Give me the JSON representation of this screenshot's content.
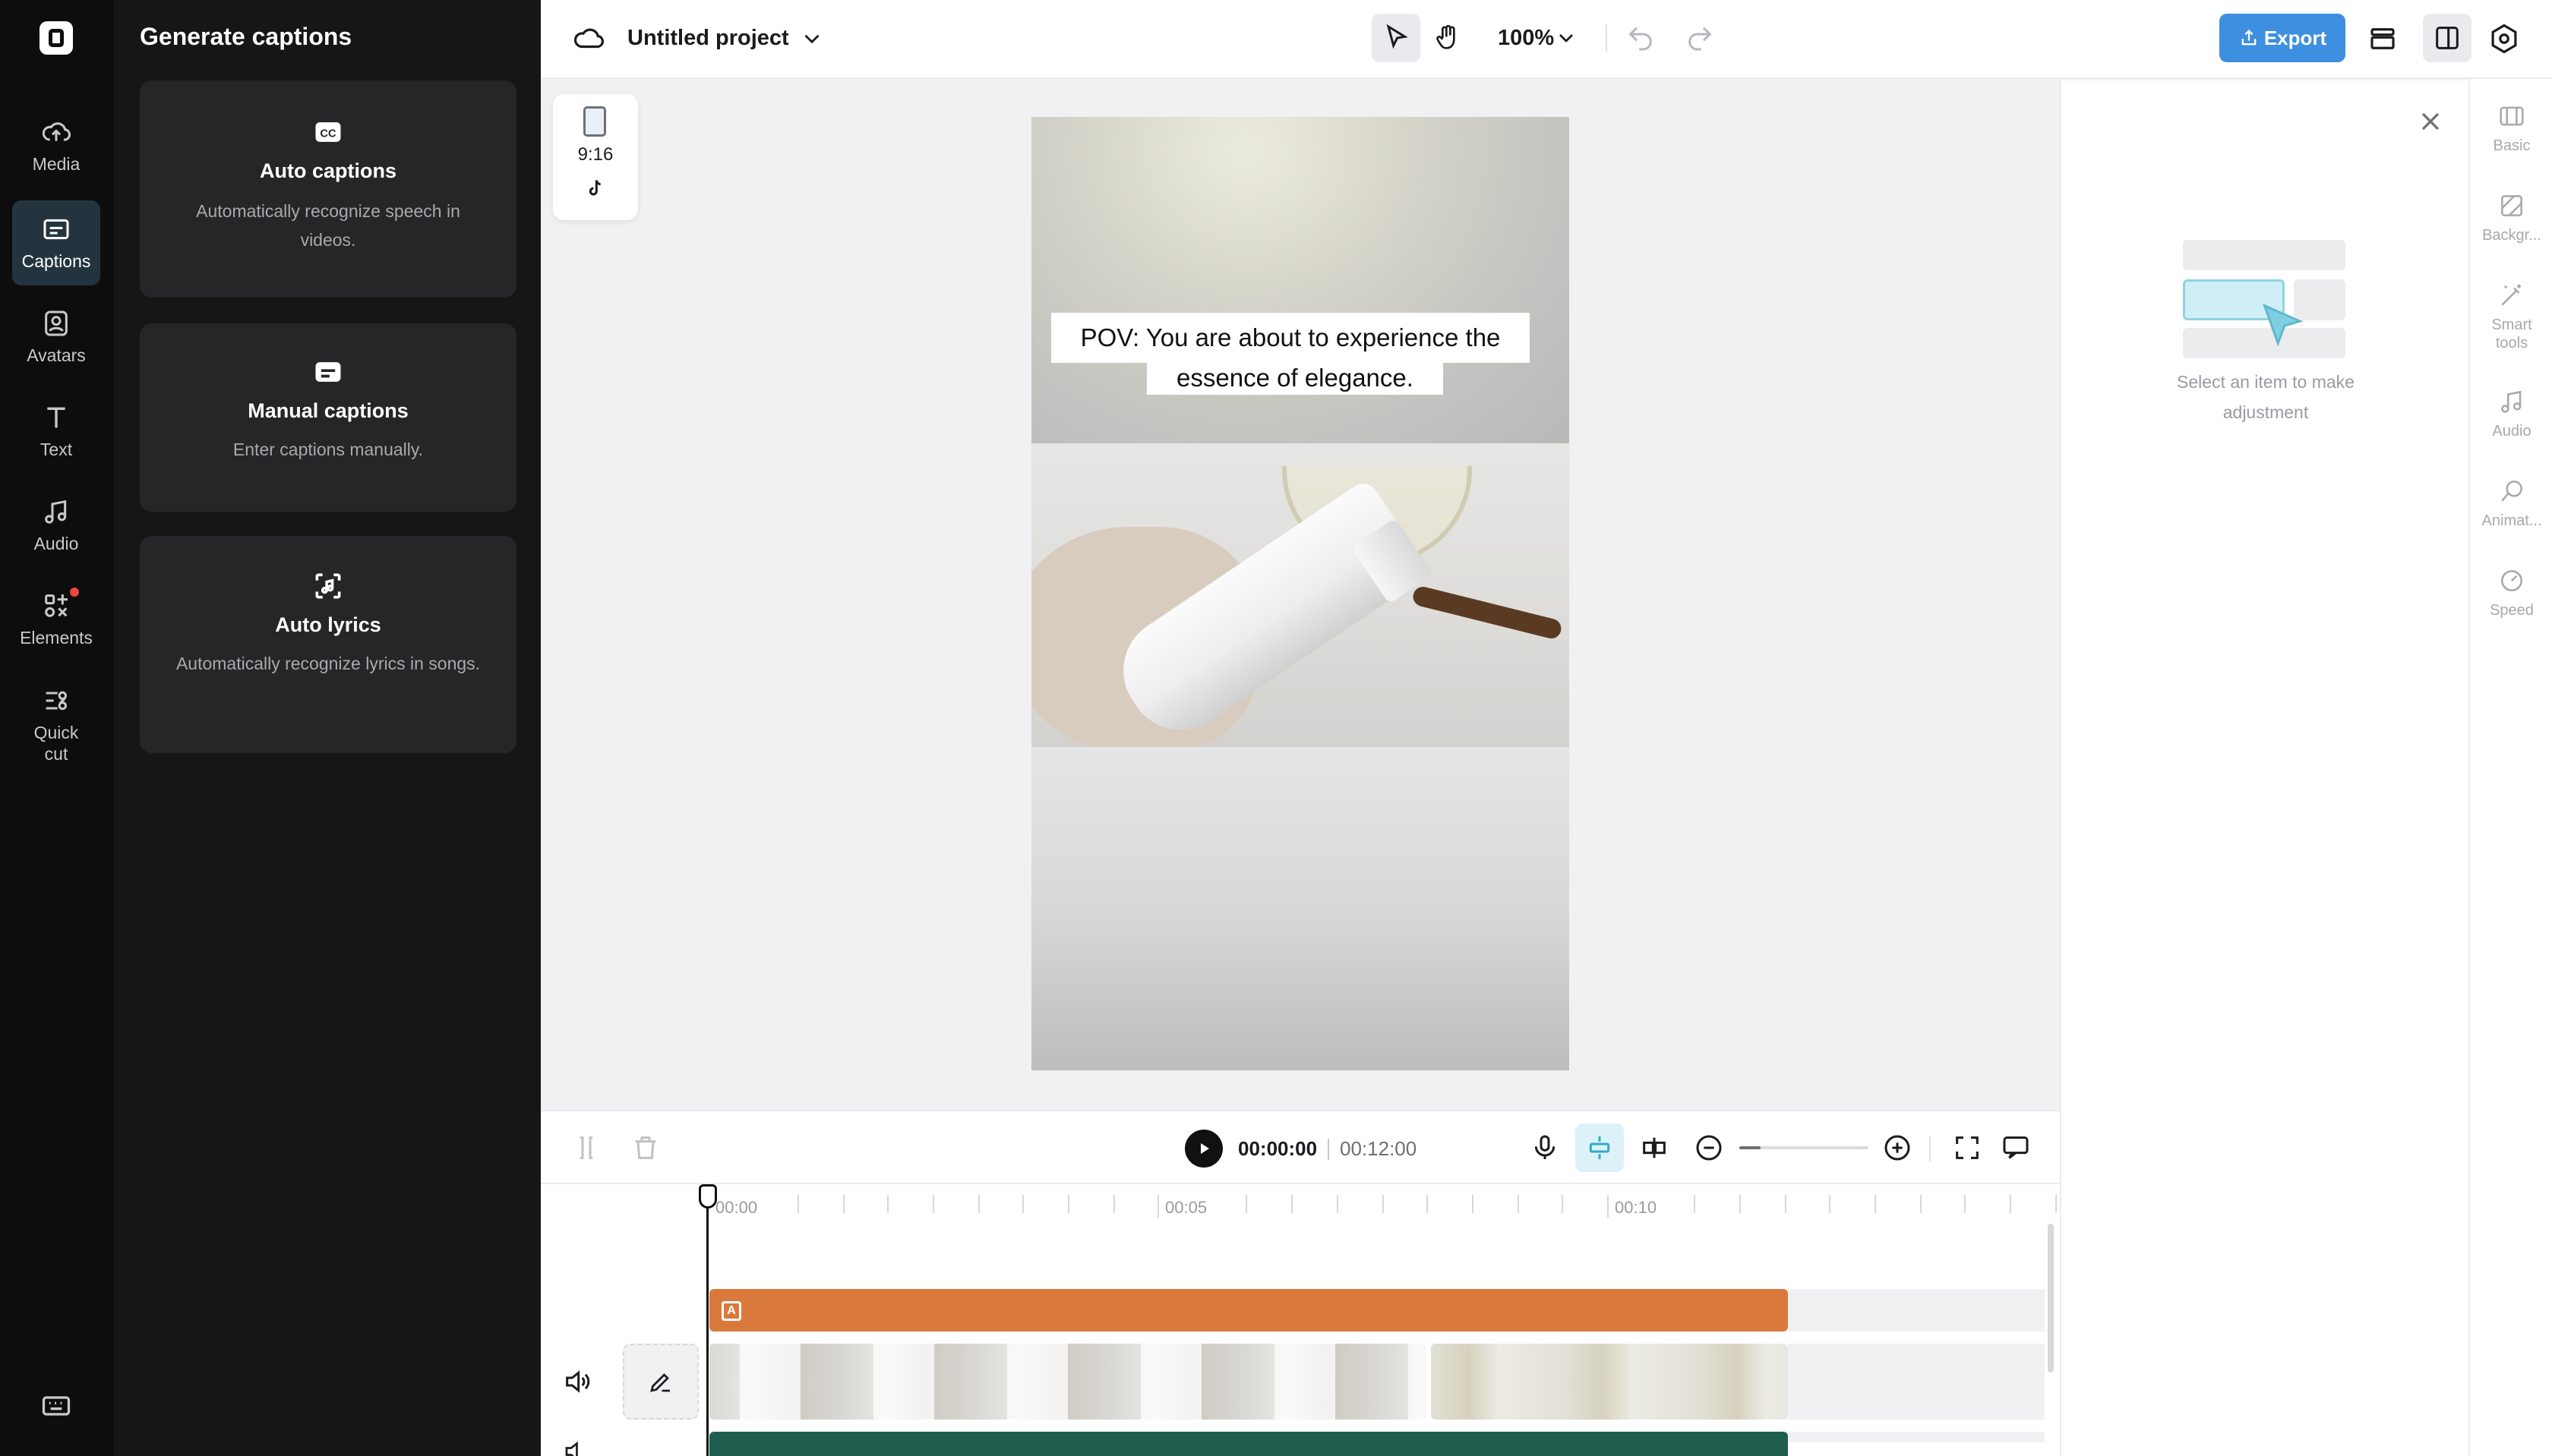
{
  "rail": {
    "items": [
      {
        "label": "Media",
        "icon": "cloud-upload-icon"
      },
      {
        "label": "Captions",
        "icon": "captions-icon",
        "active": true
      },
      {
        "label": "Avatars",
        "icon": "avatar-icon"
      },
      {
        "label": "Text",
        "icon": "text-icon"
      },
      {
        "label": "Audio",
        "icon": "music-note-icon"
      },
      {
        "label": "Elements",
        "icon": "elements-icon",
        "badge": true
      },
      {
        "label_line1": "Quick",
        "label_line2": "cut",
        "icon": "quick-cut-icon"
      }
    ],
    "bottom_icon": "keyboard-icon"
  },
  "panel": {
    "title": "Generate captions",
    "cards": [
      {
        "title": "Auto captions",
        "desc": "Automatically recognize speech in videos.",
        "icon": "cc-icon"
      },
      {
        "title": "Manual captions",
        "desc": "Enter captions manually.",
        "icon": "subtitle-icon"
      },
      {
        "title": "Auto lyrics",
        "desc": "Automatically recognize lyrics in songs.",
        "icon": "lyrics-scan-icon"
      }
    ]
  },
  "topbar": {
    "project_name": "Untitled project",
    "zoom": "100%",
    "export_label": "Export"
  },
  "canvas": {
    "ratio_label": "9:16",
    "caption_line1": "POV: You are about to experience the",
    "caption_line2": "essence of elegance."
  },
  "rightpanel": {
    "empty_line1": "Select an item to make",
    "empty_line2": "adjustment"
  },
  "righttabs": [
    {
      "label": "Basic",
      "icon": "basic-icon"
    },
    {
      "label": "Backgr...",
      "icon": "background-icon"
    },
    {
      "label_line1": "Smart",
      "label_line2": "tools",
      "icon": "magic-wand-icon"
    },
    {
      "label": "Audio",
      "icon": "audio-icon"
    },
    {
      "label": "Animat...",
      "icon": "animation-icon"
    },
    {
      "label": "Speed",
      "icon": "speed-icon"
    }
  ],
  "timeline": {
    "current_time": "00:00:00",
    "total_time": "00:12:00",
    "ruler": [
      "00:00",
      "00:05",
      "00:10"
    ]
  },
  "colors": {
    "accent": "#3d8fe0",
    "active_rail": "#24343f",
    "caption_track": "#d97a3c",
    "audio_track": "#1f5e4e"
  }
}
